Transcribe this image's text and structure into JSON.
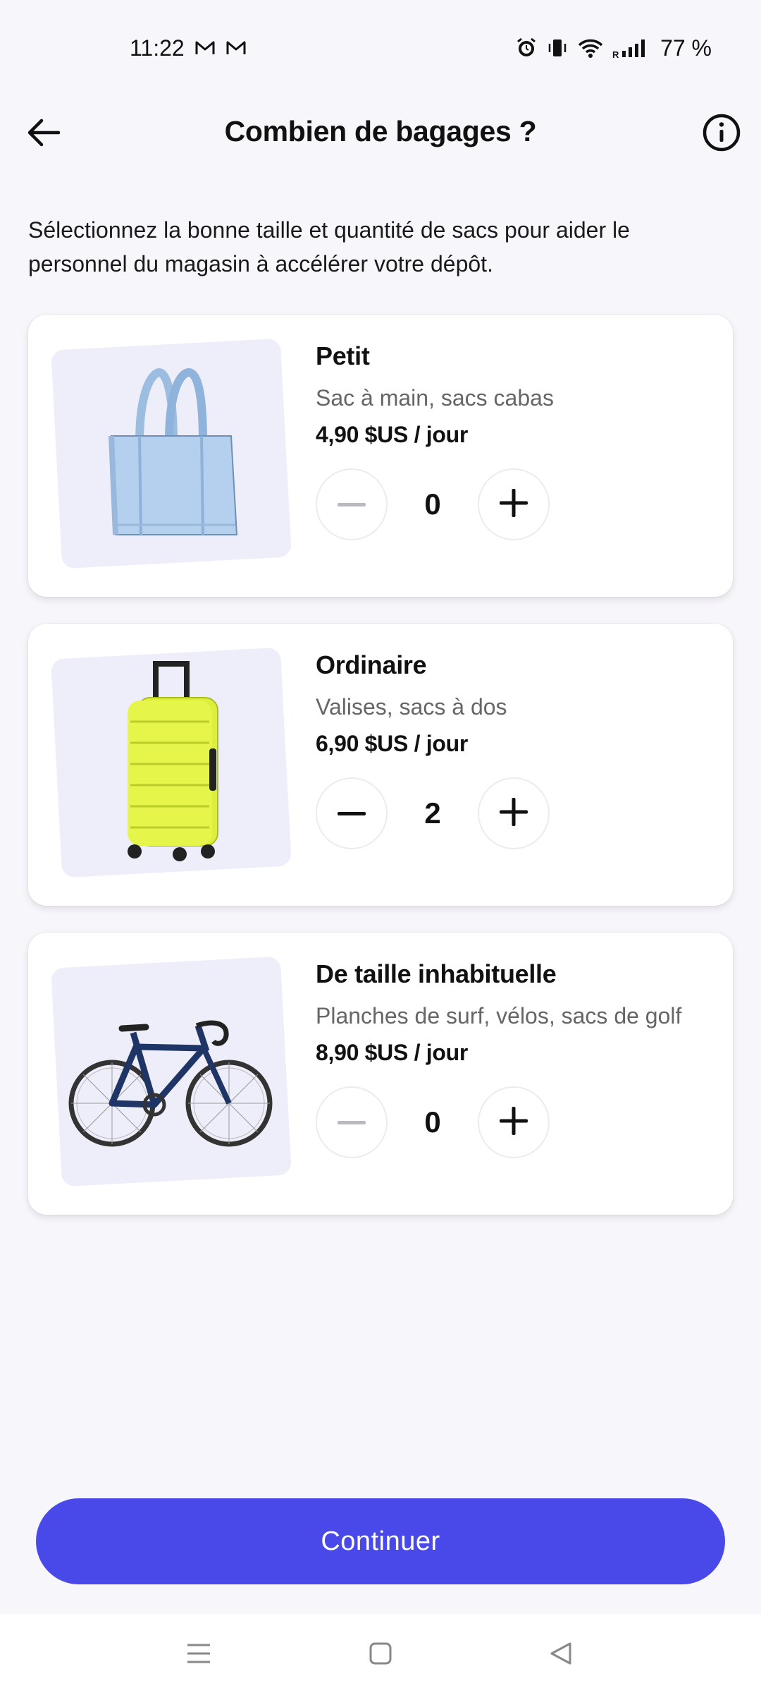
{
  "status_bar": {
    "time": "11:22",
    "battery": "77 %",
    "icons": [
      "gmail-icon",
      "gmail-icon",
      "alarm-icon",
      "vibrate-icon",
      "wifi-icon",
      "signal-icon"
    ],
    "signal_label": "R"
  },
  "header": {
    "title": "Combien de bagages ?",
    "back_icon": "arrow-left-icon",
    "info_icon": "info-icon"
  },
  "intro": "Sélectionnez la bonne taille et quantité de sacs pour aider le personnel du magasin à accélérer votre dépôt.",
  "items": [
    {
      "title": "Petit",
      "desc": "Sac à main, sacs cabas",
      "price": "4,90 $US / jour",
      "count": "0",
      "image": "tote-bag",
      "minus_enabled": false
    },
    {
      "title": "Ordinaire",
      "desc": "Valises, sacs à dos",
      "price": "6,90 $US / jour",
      "count": "2",
      "image": "suitcase",
      "minus_enabled": true
    },
    {
      "title": "De taille inhabituelle",
      "desc": "Planches de surf, vélos, sacs de golf",
      "price": "8,90 $US / jour",
      "count": "0",
      "image": "bicycle",
      "minus_enabled": false
    }
  ],
  "footer": {
    "continue_label": "Continuer"
  },
  "colors": {
    "accent": "#4949e9",
    "background": "#f7f6fb",
    "card": "#ffffff",
    "muted_text": "#666666",
    "disabled_icon": "#b9b9bf"
  }
}
